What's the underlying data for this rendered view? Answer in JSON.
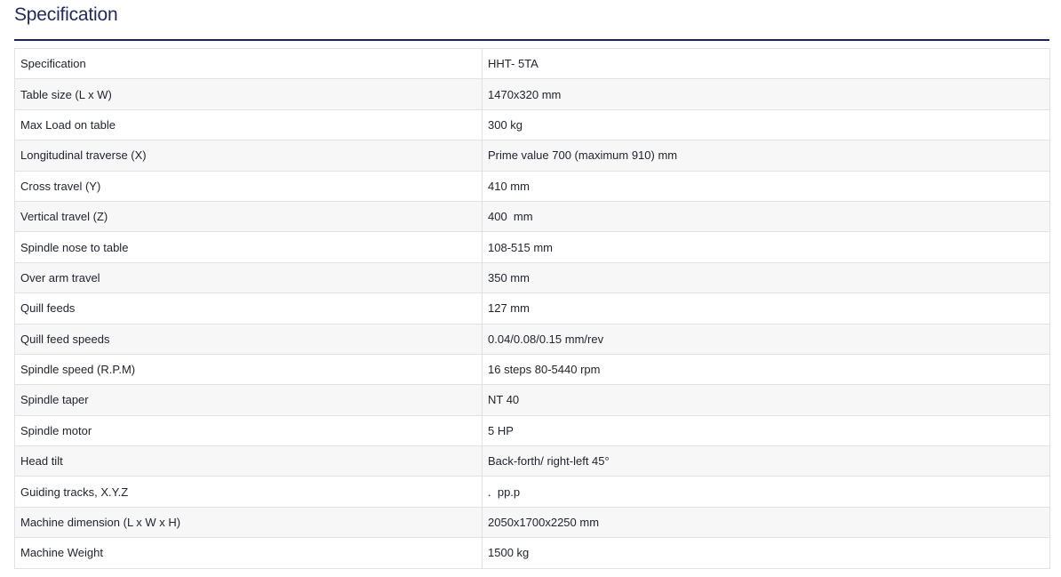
{
  "page": {
    "title": "Specification"
  },
  "table": {
    "rows": [
      {
        "label": "Specification",
        "value": "HHT- 5TA"
      },
      {
        "label": "Table size (L x W)",
        "value": "1470x320 mm"
      },
      {
        "label": "Max Load on table",
        "value": "300 kg"
      },
      {
        "label": "Longitudinal traverse (X)",
        "value": "Prime value 700 (maximum 910) mm"
      },
      {
        "label": "Cross travel (Y)",
        "value": "410 mm"
      },
      {
        "label": "Vertical travel (Z)",
        "value": "400  mm"
      },
      {
        "label": "Spindle nose to table",
        "value": "108-515 mm"
      },
      {
        "label": "Over arm travel",
        "value": "350 mm"
      },
      {
        "label": "Quill feeds",
        "value": "127 mm"
      },
      {
        "label": "Quill feed speeds",
        "value": "0.04/0.08/0.15 mm/rev"
      },
      {
        "label": "Spindle speed (R.P.M)",
        "value": "16 steps 80-5440 rpm"
      },
      {
        "label": "Spindle taper",
        "value": "NT 40"
      },
      {
        "label": "Spindle motor",
        "value": "5 HP"
      },
      {
        "label": "Head tilt",
        "value": "Back-forth/ right-left 45°"
      },
      {
        "label": "Guiding tracks, X.Y.Z",
        "value": ".  pp.p"
      },
      {
        "label": "Machine dimension (L x W x H)",
        "value": "2050x1700x2250 mm"
      },
      {
        "label": "Machine Weight",
        "value": "1500 kg"
      }
    ]
  }
}
